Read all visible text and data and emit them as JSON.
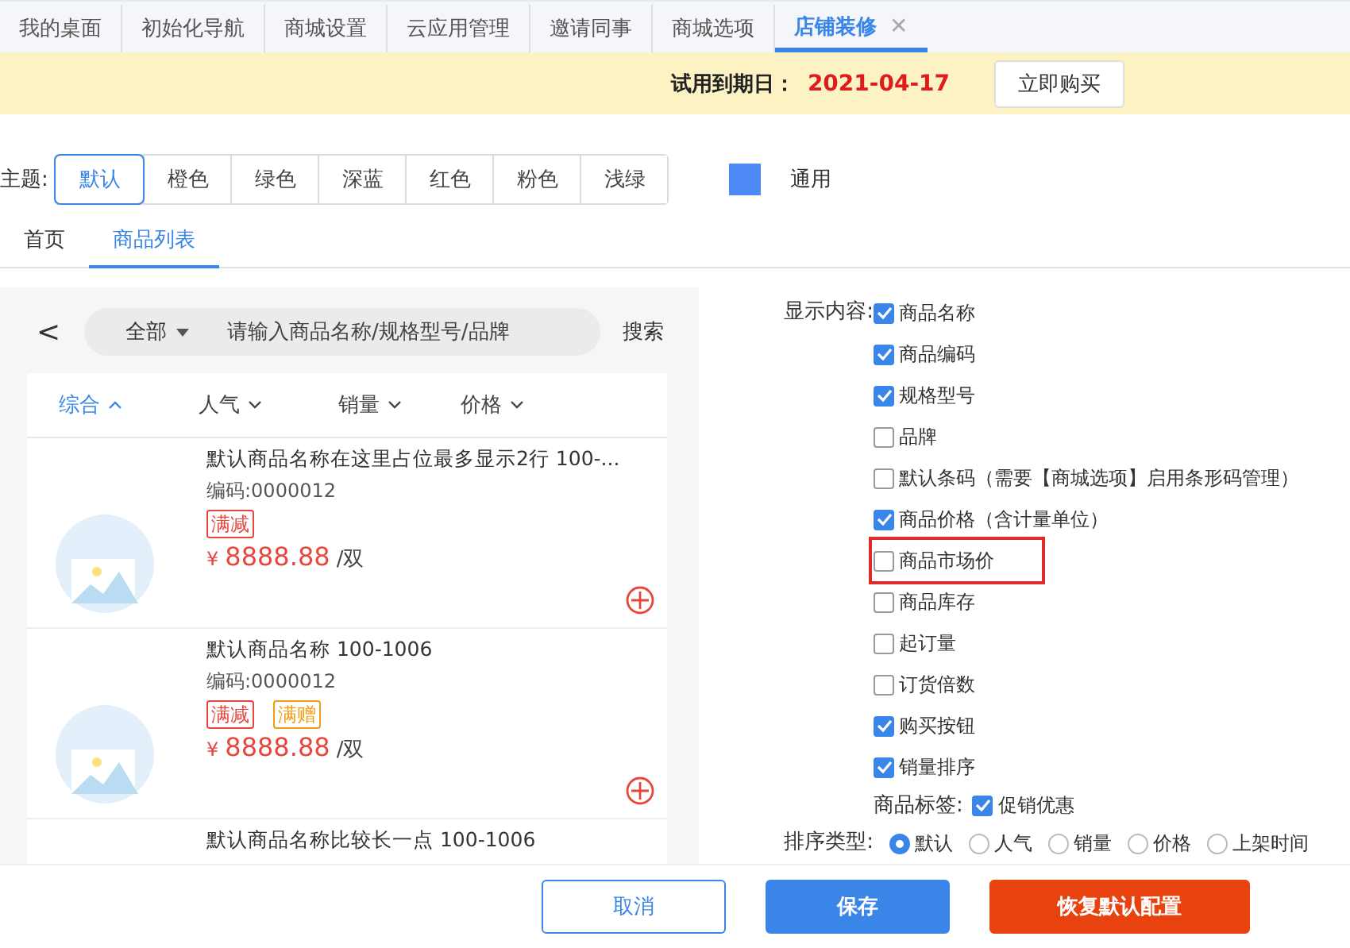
{
  "tabs": [
    {
      "label": "我的桌面",
      "selected": false,
      "closable": false
    },
    {
      "label": "初始化导航",
      "selected": false,
      "closable": false
    },
    {
      "label": "商城设置",
      "selected": false,
      "closable": false
    },
    {
      "label": "云应用管理",
      "selected": false,
      "closable": false
    },
    {
      "label": "邀请同事",
      "selected": false,
      "closable": false
    },
    {
      "label": "商城选项",
      "selected": false,
      "closable": false
    },
    {
      "label": "店铺装修",
      "selected": true,
      "closable": true,
      "close_glyph": "✕"
    }
  ],
  "trial": {
    "label": "试用到期日：",
    "date": "2021-04-17",
    "button": "立即购买"
  },
  "theme": {
    "label": "主题:",
    "options": [
      {
        "label": "默认",
        "selected": true
      },
      {
        "label": "橙色",
        "selected": false
      },
      {
        "label": "绿色",
        "selected": false
      },
      {
        "label": "深蓝",
        "selected": false
      },
      {
        "label": "红色",
        "selected": false
      },
      {
        "label": "粉色",
        "selected": false
      },
      {
        "label": "浅绿",
        "selected": false
      }
    ],
    "swatch_label": "通用"
  },
  "subtabs": [
    {
      "label": "首页",
      "selected": false
    },
    {
      "label": "商品列表",
      "selected": true
    }
  ],
  "preview": {
    "back_glyph": "<",
    "category": "全部",
    "search_placeholder": "请输入商品名称/规格型号/品牌",
    "search_button": "搜索",
    "sorts": [
      {
        "label": "综合",
        "selected": true
      },
      {
        "label": "人气",
        "selected": false
      },
      {
        "label": "销量",
        "selected": false
      },
      {
        "label": "价格",
        "selected": false
      }
    ],
    "products": [
      {
        "name": "默认商品名称在这里占位最多显示2行 100-...",
        "code": "编码:0000012",
        "tags": [
          {
            "label": "满减",
            "color": "#e8453c"
          }
        ],
        "currency": "¥",
        "price": "8888.88",
        "unit": "/双"
      },
      {
        "name": "默认商品名称 100-1006",
        "code": "编码:0000012",
        "tags": [
          {
            "label": "满减",
            "color": "#e8453c"
          },
          {
            "label": "满赠",
            "color": "#f39c12"
          }
        ],
        "currency": "¥",
        "price": "8888.88",
        "unit": "/双"
      },
      {
        "name": "默认商品名称比较长一点 100-1006"
      }
    ]
  },
  "settings": {
    "display_label": "显示内容:",
    "display_items": [
      {
        "label": "商品名称",
        "checked": true,
        "highlighted": false
      },
      {
        "label": "商品编码",
        "checked": true,
        "highlighted": false
      },
      {
        "label": "规格型号",
        "checked": true,
        "highlighted": false
      },
      {
        "label": "品牌",
        "checked": false,
        "highlighted": false
      },
      {
        "label": "默认条码（需要【商城选项】启用条形码管理）",
        "checked": false,
        "highlighted": false
      },
      {
        "label": "商品价格（含计量单位）",
        "checked": true,
        "highlighted": false
      },
      {
        "label": "商品市场价",
        "checked": false,
        "highlighted": true
      },
      {
        "label": "商品库存",
        "checked": false,
        "highlighted": false
      },
      {
        "label": "起订量",
        "checked": false,
        "highlighted": false
      },
      {
        "label": "订货倍数",
        "checked": false,
        "highlighted": false
      },
      {
        "label": "购买按钮",
        "checked": true,
        "highlighted": false
      },
      {
        "label": "销量排序",
        "checked": true,
        "highlighted": false
      }
    ],
    "tag_label": "商品标签:",
    "tag_items": [
      {
        "label": "促销优惠",
        "checked": true
      }
    ],
    "sort_label": "排序类型:",
    "sort_options": [
      {
        "label": "默认",
        "selected": true
      },
      {
        "label": "人气",
        "selected": false
      },
      {
        "label": "销量",
        "selected": false
      },
      {
        "label": "价格",
        "selected": false
      },
      {
        "label": "上架时间",
        "selected": false
      }
    ]
  },
  "buttons": [
    {
      "label": "取消",
      "kind": "outline"
    },
    {
      "label": "保存",
      "kind": "primary"
    },
    {
      "label": "恢复默认配置",
      "kind": "danger"
    }
  ]
}
